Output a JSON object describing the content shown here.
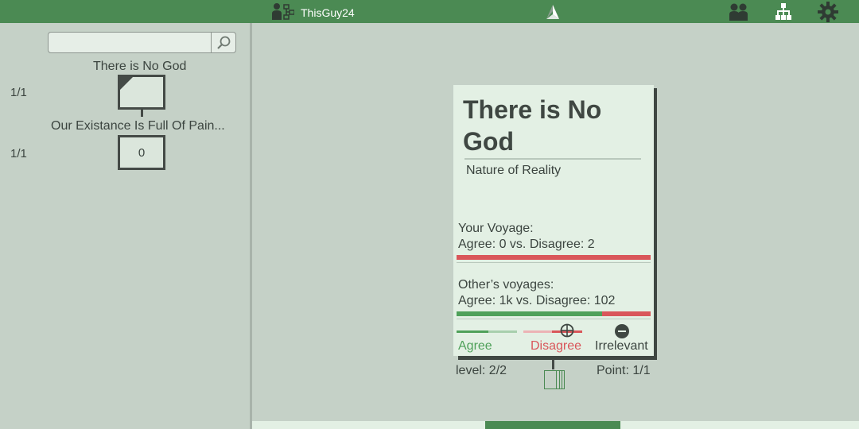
{
  "header": {
    "username": "ThisGuy24",
    "icons": [
      "users-tree-icon",
      "logo-icon",
      "people-icon",
      "hierarchy-icon",
      "gear-icon"
    ]
  },
  "sidebar": {
    "search": {
      "value": "",
      "placeholder": ""
    },
    "nodes": [
      {
        "title": "There is No God",
        "count": "1/1",
        "label": ""
      },
      {
        "title": "Our Existance Is Full Of Pain...",
        "count": "1/1",
        "label": "0"
      }
    ]
  },
  "card": {
    "title": "There is No God",
    "category": "Nature of Reality",
    "your_voyage": {
      "heading": "Your Voyage:",
      "summary": "Agree: 0 vs. Disagree: 2",
      "agree": 0,
      "disagree": 2
    },
    "others_voyage": {
      "heading": "Other’s voyages:",
      "summary": "Agree: 1k vs. Disagree: 102",
      "agree_share": 0.75
    },
    "votes": {
      "agree": "Agree",
      "disagree": "Disagree",
      "irrelevant": "Irrelevant"
    },
    "level": "level: 2/2",
    "point": "Point: 1/1"
  },
  "colors": {
    "accent": "#4b8a53",
    "agree": "#4fa15a",
    "disagree": "#d9565a",
    "background": "#c5d1c7",
    "card": "#e3f0e4"
  }
}
